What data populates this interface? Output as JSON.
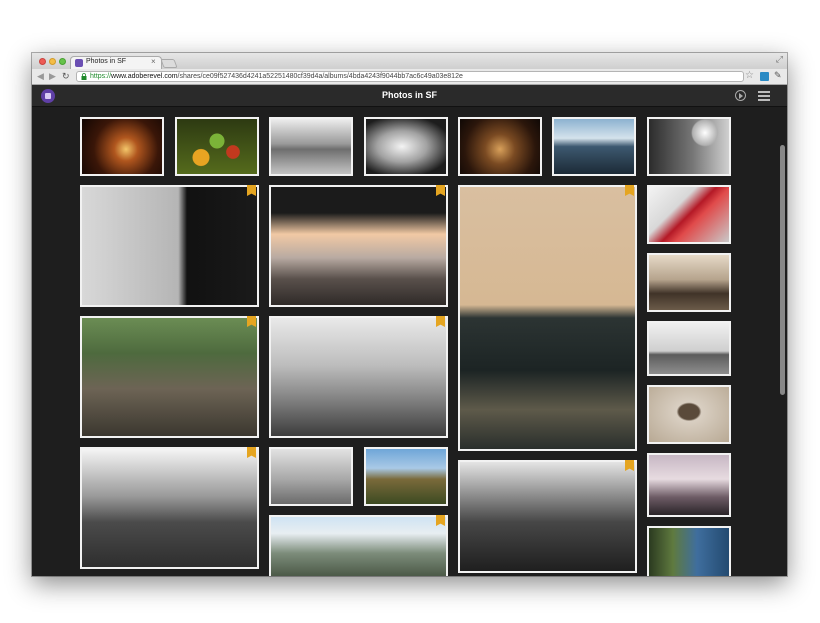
{
  "browser": {
    "tab_title": "Photos in SF",
    "tab_close": "×",
    "url_scheme": "https://",
    "url_host": "www.adoberevel.com",
    "url_path": "/shares/ce09f527436d4241a52251480cf39d4a/albums/4bda4243f9044bb7ac6c49a03e812e",
    "back_glyph": "◀",
    "forward_glyph": "▶",
    "reload_glyph": "↻",
    "star_glyph": "☆",
    "wrench_glyph": "🔧"
  },
  "app": {
    "title": "Photos in SF",
    "logo_icon": "revel-logo-icon",
    "play_icon": "slideshow-play-icon",
    "menu_icon": "list-menu-icon"
  },
  "colors": {
    "page_bg": "#1e1e1e",
    "appbar_bg": "#2a2a2a",
    "photo_border": "#f2f2f2",
    "favorite_badge": "#e5a521",
    "url_secure": "#1e8a2a"
  },
  "photos": [
    {
      "name": "candles",
      "favorite": false
    },
    {
      "name": "fruit-market",
      "favorite": false
    },
    {
      "name": "geese",
      "favorite": false
    },
    {
      "name": "bread",
      "favorite": false
    },
    {
      "name": "dining-table",
      "favorite": false
    },
    {
      "name": "boat-harbor",
      "favorite": false
    },
    {
      "name": "vintage-car-interior",
      "favorite": false
    },
    {
      "name": "chandelier",
      "favorite": true
    },
    {
      "name": "sailboat-sunset",
      "favorite": true
    },
    {
      "name": "surfer",
      "favorite": true
    },
    {
      "name": "red-car-fin",
      "favorite": false
    },
    {
      "name": "vintage-truck",
      "favorite": false
    },
    {
      "name": "market-street",
      "favorite": true
    },
    {
      "name": "coin-binoculars",
      "favorite": true
    },
    {
      "name": "skyline",
      "favorite": false
    },
    {
      "name": "area-closed-sign",
      "favorite": false
    },
    {
      "name": "ocean-cliffs",
      "favorite": true
    },
    {
      "name": "driftwood-sculpture",
      "favorite": false
    },
    {
      "name": "hillside-houses",
      "favorite": false
    },
    {
      "name": "yosemite-valley",
      "favorite": true
    },
    {
      "name": "mountain-panorama",
      "favorite": true
    },
    {
      "name": "billboard",
      "favorite": false
    },
    {
      "name": "palm-building",
      "favorite": false
    }
  ]
}
